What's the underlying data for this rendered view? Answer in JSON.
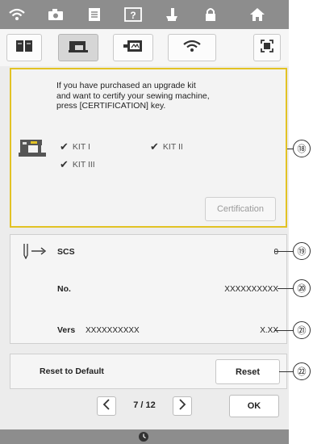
{
  "top_bar": {
    "icons": [
      "wifi-icon",
      "camera-icon",
      "document-icon",
      "help-icon",
      "sewing-foot-icon",
      "lock-icon",
      "home-icon"
    ]
  },
  "tabs": [
    {
      "icon": "book-icon",
      "active": false
    },
    {
      "icon": "sewing-machine-icon",
      "active": true
    },
    {
      "icon": "embroidery-frame-icon",
      "active": false
    },
    {
      "icon": "wifi-icon",
      "active": false
    }
  ],
  "certification": {
    "message": "If you have purchased an upgrade kit\nand want to certify your sewing machine,\npress [CERTIFICATION] key.",
    "kits": [
      "KIT I",
      "KIT II",
      "KIT III"
    ],
    "button_label": "Certification"
  },
  "info": {
    "scs_label": "SCS",
    "scs_value": "0",
    "no_label": "No.",
    "no_value": "XXXXXXXXXX",
    "vers_label": "Vers",
    "vers_code": "XXXXXXXXXX",
    "vers_value": "X.XX"
  },
  "reset": {
    "label": "Reset to Default",
    "button_label": "Reset"
  },
  "pager": {
    "page_text": "7 / 12",
    "ok_label": "OK"
  },
  "callouts": [
    "⑱",
    "⑲",
    "⑳",
    "㉑",
    "㉒"
  ],
  "colors": {
    "highlight": "#e2c224",
    "top_bar": "#8d8d8d"
  }
}
